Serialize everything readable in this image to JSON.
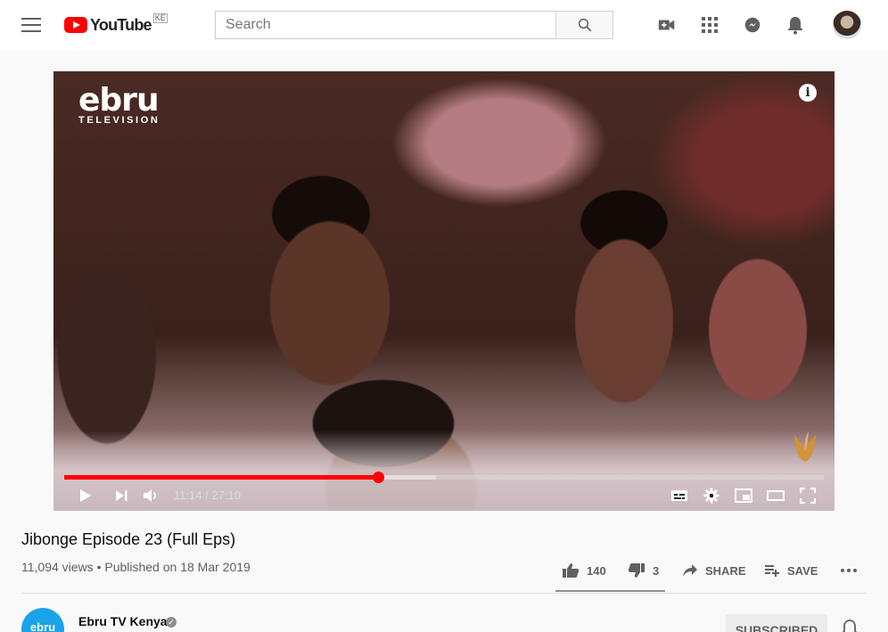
{
  "header": {
    "logo_text": "YouTube",
    "country_code": "KE",
    "search_placeholder": "Search"
  },
  "player": {
    "channel_logo": "ebru",
    "channel_logo_sub": "TELEVISION",
    "current_time": "11:14",
    "duration": "27:10",
    "time_display": "11:14 / 27:10",
    "progress_played": 0.4134,
    "progress_buffered": 0.49,
    "accent_color": "#ff0000"
  },
  "video": {
    "title": "Jibonge Episode 23 (Full Eps)",
    "meta": "11,094 views • Published on 18 Mar 2019",
    "likes": "140",
    "dislikes": "3",
    "share_label": "SHARE",
    "save_label": "SAVE"
  },
  "channel": {
    "avatar_text": "ebru",
    "name": "Ebru TV Kenya",
    "subscribe_label": "SUBSCRIBED"
  }
}
